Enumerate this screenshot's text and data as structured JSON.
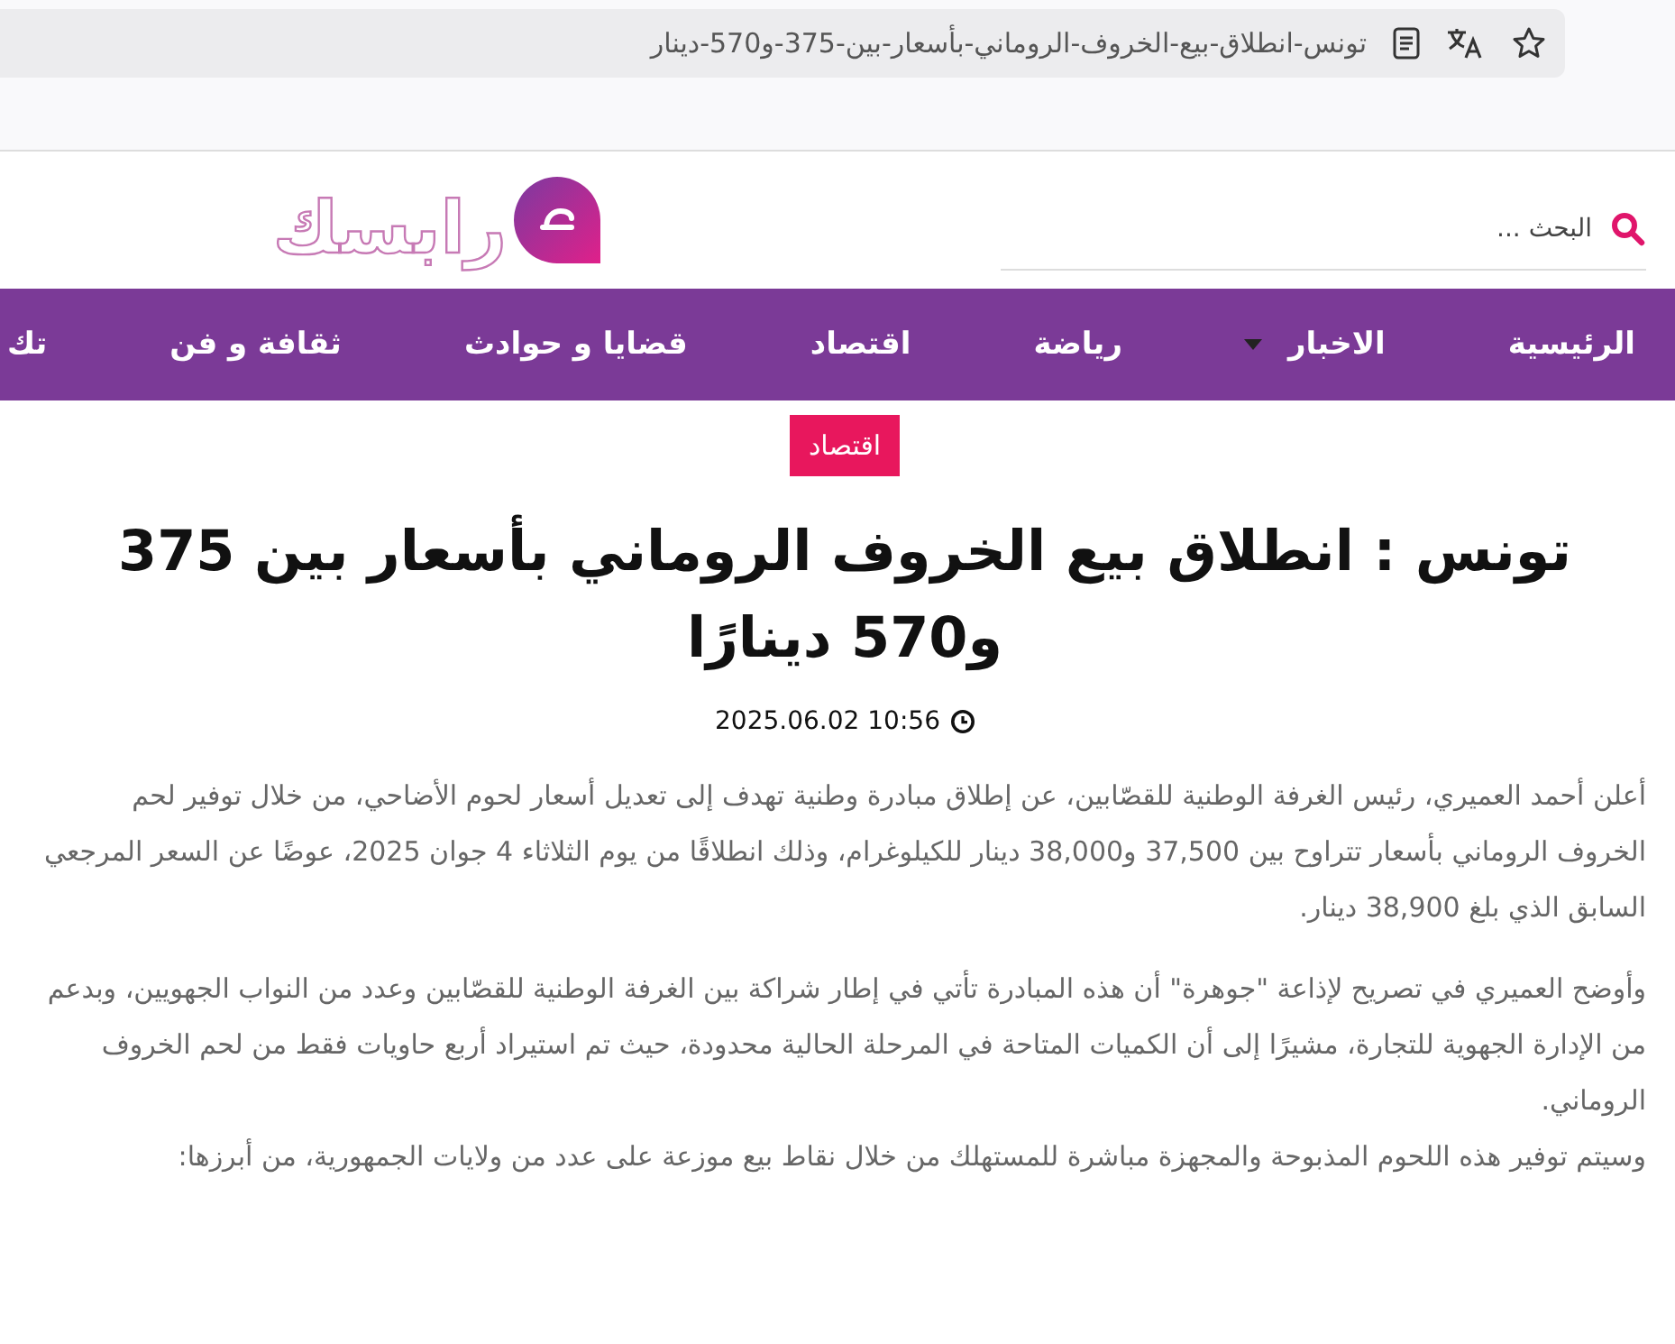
{
  "browser": {
    "url": "تونس-انطلاق-بيع-الخروف-الروماني-بأسعار-بين-375-و570-دينار"
  },
  "header": {
    "logo_text": "رابسك",
    "search": {
      "placeholder": "البحث ..."
    }
  },
  "nav": [
    {
      "label": "الرئيسية",
      "dropdown": false
    },
    {
      "label": "الاخبار",
      "dropdown": true
    },
    {
      "label": "رياضة",
      "dropdown": false
    },
    {
      "label": "اقتصاد",
      "dropdown": false
    },
    {
      "label": "قضايا و حوادث",
      "dropdown": false
    },
    {
      "label": "ثقافة و فن",
      "dropdown": false
    },
    {
      "label": "تك",
      "dropdown": false
    }
  ],
  "article": {
    "category": "اقتصاد",
    "title": "تونس : انطلاق بيع الخروف الروماني بأسعار بين 375 و570 دينارًا",
    "date": "10:56 2025.06.02",
    "paragraphs": [
      [
        "أعلن أحمد العميري، رئيس الغرفة الوطنية للقصّابين، عن إطلاق مبادرة وطنية تهدف إلى تعديل أسعار لحوم الأضاحي، من خلال توفير لحم الخروف الروماني بأسعار تتراوح بين 37,500 و38,000 دينار للكيلوغرام، وذلك انطلاقًا من يوم الثلاثاء 4 جوان 2025، عوضًا عن السعر المرجعي السابق الذي بلغ 38,900 دينار."
      ],
      [
        "وأوضح العميري في تصريح لإذاعة \"جوهرة\" أن هذه المبادرة تأتي في إطار شراكة بين الغرفة الوطنية للقصّابين وعدد من النواب الجهويين، وبدعم من الإدارة الجهوية للتجارة، مشيرًا إلى أن الكميات المتاحة في المرحلة الحالية محدودة، حيث تم استيراد أربع حاويات فقط من لحم الخروف الروماني.",
        "وسيتم توفير هذه اللحوم المذبوحة والمجهزة مباشرة للمستهلك من خلال نقاط بيع موزعة على عدد من ولايات الجمهورية، من أبرزها:"
      ]
    ]
  }
}
